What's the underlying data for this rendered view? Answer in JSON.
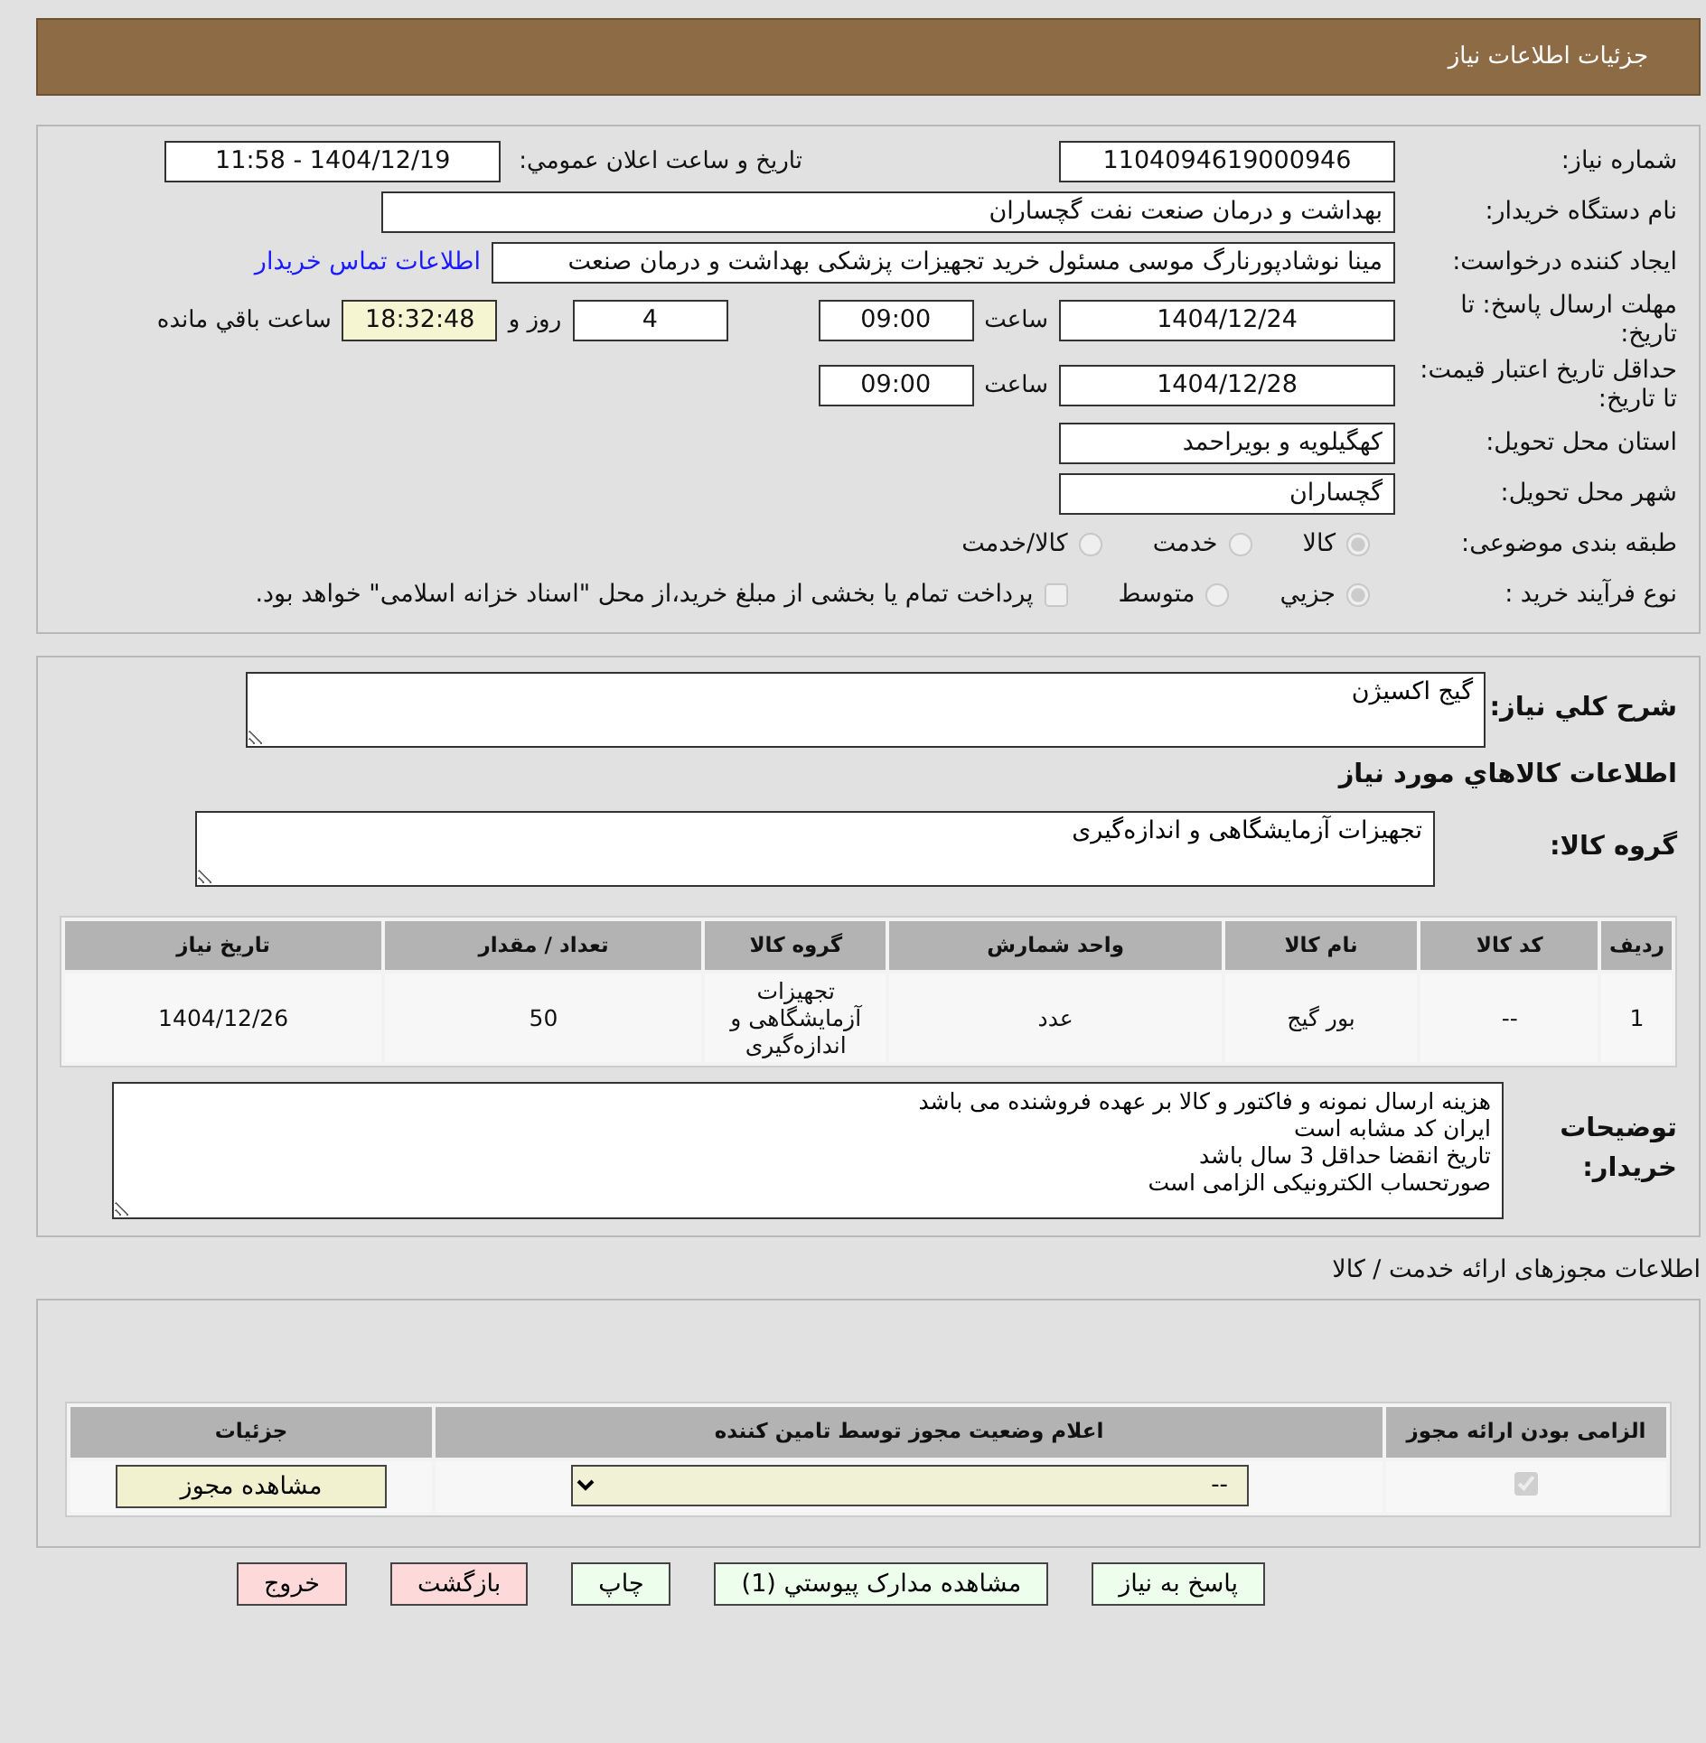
{
  "header": {
    "title": "جزئیات اطلاعات نیاز"
  },
  "need_info": {
    "need_number": {
      "label": "شماره نیاز:",
      "value": "1104094619000946"
    },
    "announce": {
      "label": "تاریخ و ساعت اعلان عمومي:",
      "value": "1404/12/19 - 11:58"
    },
    "buyer": {
      "label": "نام دستگاه خريدار:",
      "value": "بهداشت و درمان صنعت نفت گچساران"
    },
    "requester": {
      "label": "ایجاد کننده درخواست:",
      "value": "مینا نوشادپورنارگ موسی مسئول خرید تجهیزات پزشکی  بهداشت و درمان صنعت",
      "link": "اطلاعات تماس خریدار"
    },
    "deadline": {
      "label": "مهلت ارسال پاسخ: تا تاریخ:",
      "date": "1404/12/24",
      "time_label": "ساعت",
      "time": "09:00",
      "days": "4",
      "days_label": "روز و",
      "remaining": "18:32:48",
      "remaining_label": "ساعت باقي مانده"
    },
    "validity": {
      "label": "حداقل تاریخ اعتبار قیمت: تا تاریخ:",
      "date": "1404/12/28",
      "time_label": "ساعت",
      "time": "09:00"
    },
    "province": {
      "label": "استان محل تحویل:",
      "value": "کهگیلویه و بویراحمد"
    },
    "city": {
      "label": "شهر محل تحویل:",
      "value": "گچساران"
    },
    "category": {
      "label": "طبقه بندی موضوعی:",
      "options": [
        {
          "label": "کالا",
          "selected": true
        },
        {
          "label": "خدمت",
          "selected": false
        },
        {
          "label": "کالا/خدمت",
          "selected": false
        }
      ]
    },
    "process": {
      "label": "نوع فرآیند خرید :",
      "options": [
        {
          "label": "جزيي",
          "selected": true
        },
        {
          "label": "متوسط",
          "selected": false
        }
      ],
      "payment": {
        "label": "پرداخت تمام یا بخشی از مبلغ خرید،از محل \"اسناد خزانه اسلامی\" خواهد بود.",
        "checked": false
      }
    }
  },
  "goods": {
    "description": {
      "label": "شرح کلي نیاز:",
      "value": "گیج اکسیژن"
    },
    "heading": "اطلاعات کالاهاي مورد نیاز",
    "group": {
      "label": "گروه کالا:",
      "value": "تجهیزات آزمایشگاهی و اندازه‌گیری"
    },
    "table": {
      "columns": [
        "ردیف",
        "کد کالا",
        "نام کالا",
        "واحد شمارش",
        "گروه کالا",
        "تعداد / مقدار",
        "تاریخ نیاز"
      ],
      "rows": [
        [
          "1",
          "--",
          "بور گیج",
          "عدد",
          "تجهیزات آزمایشگاهی و اندازه‌گیری",
          "50",
          "1404/12/26"
        ]
      ]
    },
    "notes": {
      "label": "توضیحات خریدار:",
      "lines": [
        "هزینه ارسال نمونه و فاکتور و کالا بر عهده فروشنده می باشد",
        "ایران کد مشابه است",
        "تاریخ انقضا حداقل 3 سال باشد",
        "صورتحساب الکترونیکی الزامی است"
      ]
    }
  },
  "permits": {
    "title": "اطلاعات مجوزهای ارائه خدمت / کالا",
    "columns": [
      "الزامی بودن ارائه مجوز",
      "اعلام وضعیت مجوز توسط تامین کننده",
      "جزئیات"
    ],
    "rows": [
      {
        "required": true,
        "status": "--",
        "button": "مشاهده مجوز"
      }
    ]
  },
  "buttons": [
    {
      "label": "پاسخ به نیاز",
      "kind": "normal"
    },
    {
      "label": "مشاهده مدارک پیوستي (1)",
      "kind": "normal"
    },
    {
      "label": "چاپ",
      "kind": "normal"
    },
    {
      "label": "بازگشت",
      "kind": "warning"
    },
    {
      "label": "خروج",
      "kind": "warning"
    }
  ]
}
